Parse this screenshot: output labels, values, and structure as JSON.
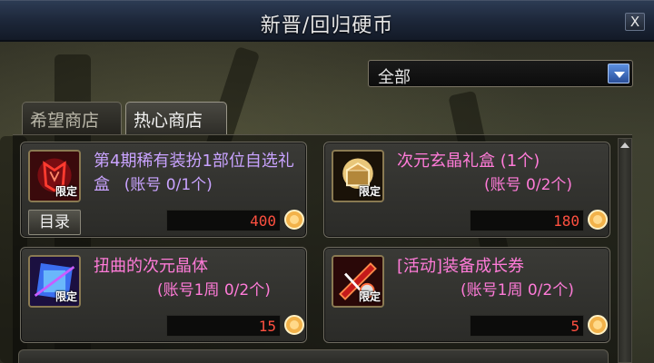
{
  "window": {
    "title": "新晋/回归硬币",
    "close_label": "X"
  },
  "filter": {
    "selected": "全部"
  },
  "tabs": [
    {
      "label": "希望商店",
      "active": false
    },
    {
      "label": "热心商店",
      "active": true
    }
  ],
  "items": [
    {
      "name": "第4期稀有装扮1部位自选礼盒",
      "limit": "(账号 0/1个)",
      "price": "400",
      "tag": "限定",
      "icon": "red-armor-icon",
      "has_catalog": true,
      "catalog_label": "目录",
      "color": "#c9a3ff"
    },
    {
      "name": "次元玄晶礼盒 (1个)",
      "limit": "(账号 0/2个)",
      "price": "180",
      "tag": "限定",
      "icon": "golden-box-icon",
      "has_catalog": false,
      "color": "#ff7bd8"
    },
    {
      "name": "扭曲的次元晶体",
      "limit": "(账号1周 0/2个)",
      "price": "15",
      "tag": "限定",
      "icon": "blue-crystal-icon",
      "has_catalog": false,
      "color": "#ff7bd8"
    },
    {
      "name": "[活动]装备成长券",
      "limit": "(账号1周 0/2个)",
      "price": "5",
      "tag": "限定",
      "icon": "equipment-ticket-icon",
      "has_catalog": false,
      "color": "#ff7bd8"
    }
  ],
  "colors": {
    "price": "#ff5040",
    "title_bar": "#1c2638",
    "accent_blue": "#2a4f9a"
  }
}
